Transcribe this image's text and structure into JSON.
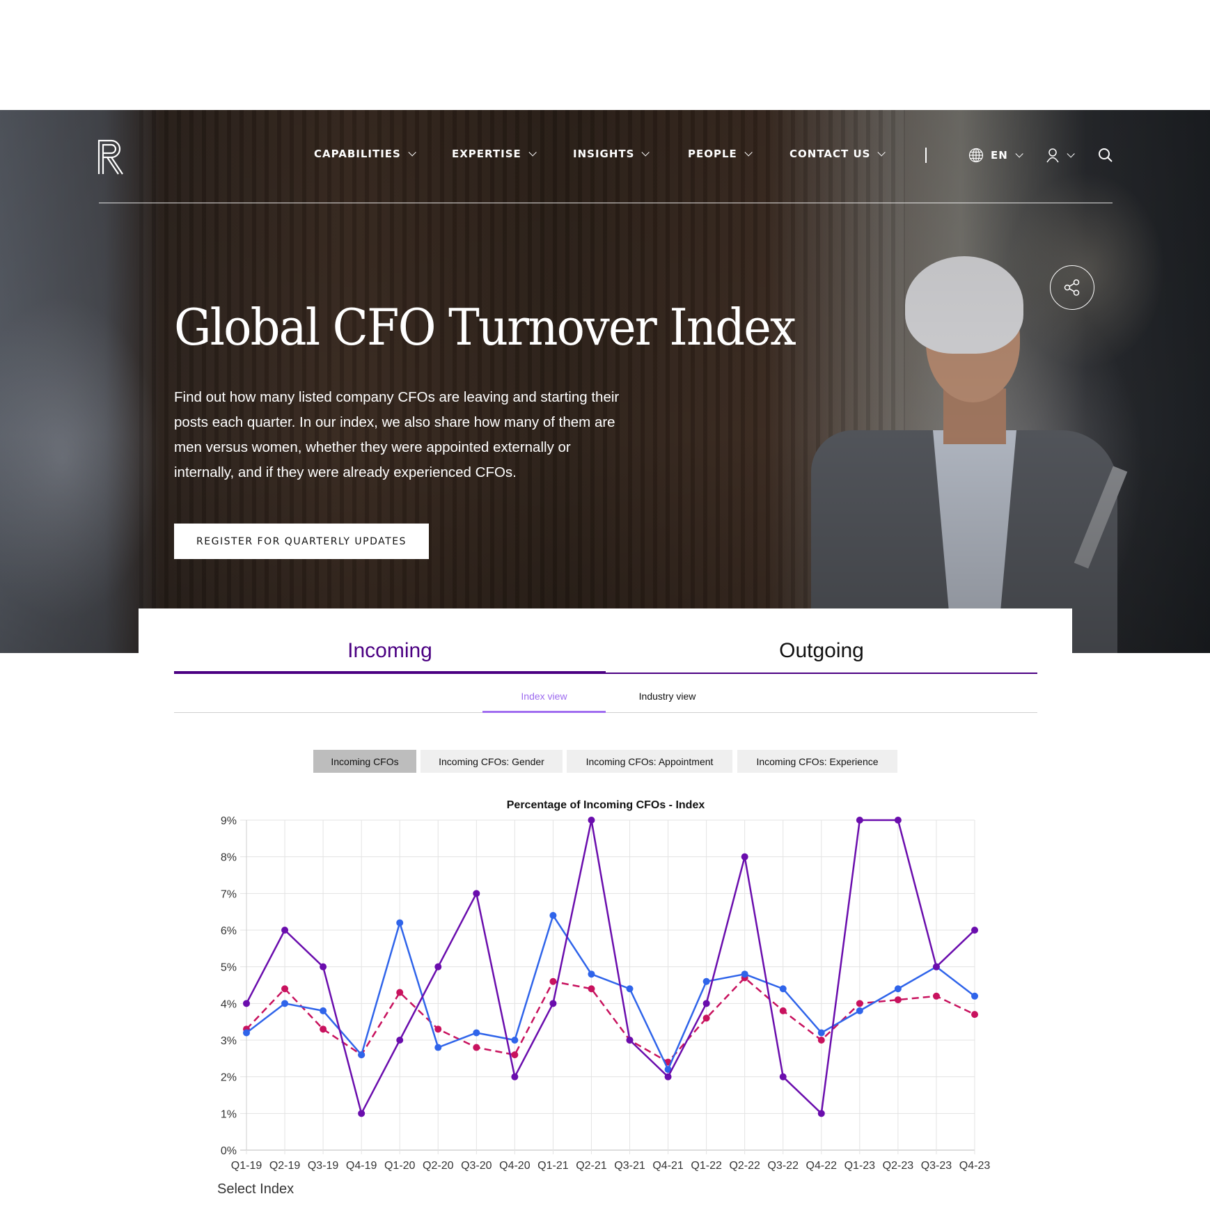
{
  "header": {
    "logo_letter": "R",
    "nav": [
      {
        "label": "CAPABILITIES"
      },
      {
        "label": "EXPERTISE"
      },
      {
        "label": "INSIGHTS"
      },
      {
        "label": "PEOPLE"
      },
      {
        "label": "CONTACT US"
      }
    ],
    "language": "EN",
    "icons": {
      "globe": "globe-icon",
      "user": "user-icon",
      "search": "search-icon",
      "share": "share-icon"
    }
  },
  "hero": {
    "title": "Global CFO Turnover Index",
    "description": "Find out how many listed company CFOs are leaving and starting their posts each quarter. In our index, we also share how many of them are men versus women, whether they were appointed externally or internally, and if they were already experienced CFOs.",
    "cta_label": "REGISTER FOR QUARTERLY UPDATES"
  },
  "tabs": {
    "main": [
      {
        "label": "Incoming",
        "active": true
      },
      {
        "label": "Outgoing",
        "active": false
      }
    ],
    "sub": [
      {
        "label": "Index view",
        "active": true
      },
      {
        "label": "Industry view",
        "active": false
      }
    ],
    "pills": [
      {
        "label": "Incoming CFOs",
        "active": true
      },
      {
        "label": "Incoming CFOs: Gender",
        "active": false
      },
      {
        "label": "Incoming CFOs: Appointment",
        "active": false
      },
      {
        "label": "Incoming CFOs: Experience",
        "active": false
      }
    ]
  },
  "select_index_label": "Select Index",
  "colors": {
    "brand_purple": "#4b0082",
    "subtab_accent": "#a06df0",
    "series_purple": "#6a0dad",
    "series_blue": "#2f64ea",
    "series_pink": "#c8125e"
  },
  "chart_data": {
    "type": "line",
    "title": "Percentage of Incoming CFOs - Index",
    "xlabel": "",
    "ylabel": "",
    "categories": [
      "Q1-19",
      "Q2-19",
      "Q3-19",
      "Q4-19",
      "Q1-20",
      "Q2-20",
      "Q3-20",
      "Q4-20",
      "Q1-21",
      "Q2-21",
      "Q3-21",
      "Q4-21",
      "Q1-22",
      "Q2-22",
      "Q3-22",
      "Q4-22",
      "Q1-23",
      "Q2-23",
      "Q3-23",
      "Q4-23"
    ],
    "yticks": [
      "0%",
      "1%",
      "2%",
      "3%",
      "4%",
      "5%",
      "6%",
      "7%",
      "8%",
      "9%"
    ],
    "ylim": [
      0,
      9
    ],
    "grid": true,
    "legend": "none",
    "series": [
      {
        "name": "Series 1 (purple, solid)",
        "color": "#6a0dad",
        "dashed": false,
        "values": [
          4,
          6,
          5,
          1,
          3,
          5,
          7,
          2,
          4,
          9,
          3,
          2,
          4,
          8,
          2,
          1,
          9,
          9,
          5,
          6
        ]
      },
      {
        "name": "Series 2 (blue, solid)",
        "color": "#2f64ea",
        "dashed": false,
        "values": [
          3.2,
          4.0,
          3.8,
          2.6,
          6.2,
          2.8,
          3.2,
          3.0,
          6.4,
          4.8,
          4.4,
          2.2,
          4.6,
          4.8,
          4.4,
          3.2,
          3.8,
          4.4,
          5.0,
          4.2
        ]
      },
      {
        "name": "Series 3 (pink, dashed)",
        "color": "#c8125e",
        "dashed": true,
        "values": [
          3.3,
          4.4,
          3.3,
          2.6,
          4.3,
          3.3,
          2.8,
          2.6,
          4.6,
          4.4,
          3.0,
          2.4,
          3.6,
          4.7,
          3.8,
          3.0,
          4.0,
          4.1,
          4.2,
          3.7
        ]
      }
    ]
  }
}
